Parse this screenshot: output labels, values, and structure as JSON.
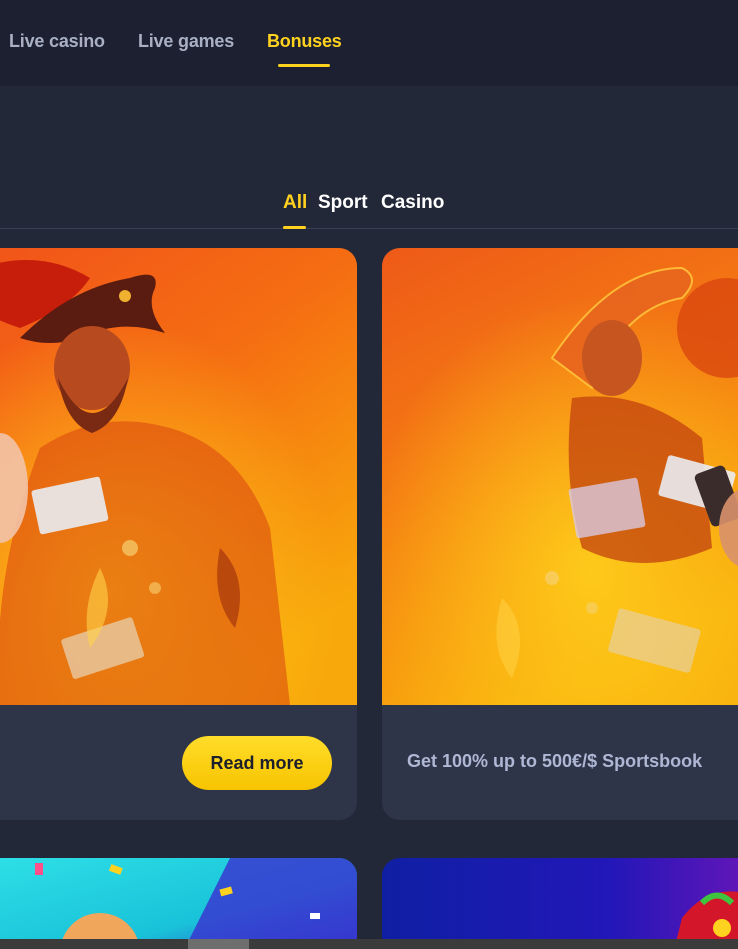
{
  "nav": {
    "items": [
      {
        "label": "Live casino",
        "active": false
      },
      {
        "label": "Live games",
        "active": false
      },
      {
        "label": "Bonuses",
        "active": true
      }
    ]
  },
  "filters": {
    "tabs": [
      {
        "label": "All",
        "active": true
      },
      {
        "label": "Sport",
        "active": false
      },
      {
        "label": "Casino",
        "active": false
      }
    ]
  },
  "cards": [
    {
      "image": "pirate-with-banknotes-illustration",
      "button_label": "Read more"
    },
    {
      "image": "athlete-with-banknotes-illustration",
      "text": "Get 100% up to 500€/$ Sportsbook"
    }
  ],
  "colors": {
    "accent": "#ffd21f",
    "background": "#232838",
    "nav_background": "#1c2030",
    "card_footer": "#2f3548",
    "muted_text": "#a9b0c4"
  }
}
